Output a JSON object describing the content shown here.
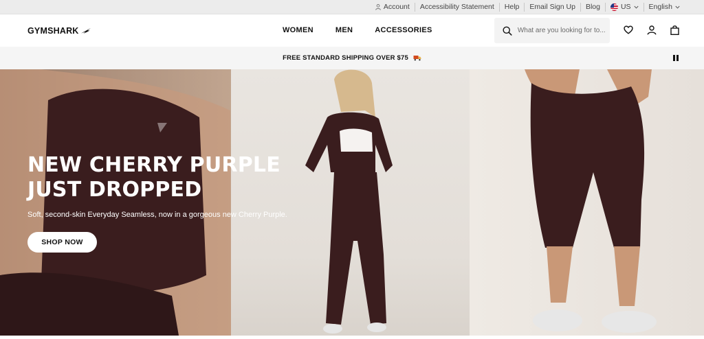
{
  "util_bar": {
    "account": "Account",
    "accessibility": "Accessibility Statement",
    "help": "Help",
    "email_signup": "Email Sign Up",
    "blog": "Blog",
    "region": "US",
    "language": "English"
  },
  "header": {
    "logo": "GYMSHARK",
    "nav": [
      "WOMEN",
      "MEN",
      "ACCESSORIES"
    ],
    "search_placeholder": "What are you looking for to..."
  },
  "promo": {
    "text": "FREE STANDARD SHIPPING OVER $75"
  },
  "hero": {
    "headline_line1": "NEW CHERRY PURPLE",
    "headline_line2": "JUST DROPPED",
    "subtitle": "Soft, second-skin Everyday Seamless, now in a gorgeous new Cherry Purple.",
    "cta": "SHOP NOW"
  },
  "icons": {
    "account": "person-icon",
    "search": "search-icon",
    "wishlist": "heart-icon",
    "profile": "user-icon",
    "bag": "bag-icon",
    "dropdown": "chevron-down-icon",
    "promo": "truck-icon",
    "pause": "pause-icon"
  },
  "colors": {
    "garment": "#3a1d1e",
    "util_bar_bg": "#ececec",
    "promo_bg": "#f5f5f5"
  }
}
